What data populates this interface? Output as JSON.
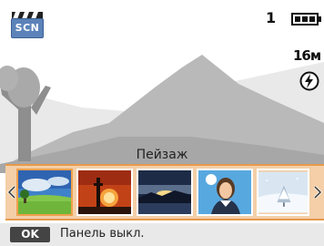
{
  "status": {
    "scene_mode_badge": "SCN",
    "shot_count": "1",
    "resolution": "16м",
    "battery_icon": "battery-full-icon",
    "flash_icon": "flash-auto-icon"
  },
  "scene": {
    "current_name": "Пейзаж",
    "thumbnails": [
      {
        "name": "landscape",
        "icon": "landscape-thumbnail",
        "selected": true
      },
      {
        "name": "sunset",
        "icon": "sunset-thumbnail",
        "selected": false
      },
      {
        "name": "dawn",
        "icon": "dawn-thumbnail",
        "selected": false
      },
      {
        "name": "portrait",
        "icon": "portrait-thumbnail",
        "selected": false
      },
      {
        "name": "snow",
        "icon": "snow-thumbnail",
        "selected": false
      }
    ]
  },
  "bottom_bar": {
    "key_label": "OK",
    "label": "Панель выкл."
  },
  "colors": {
    "strip_bg": "#f4cfa8",
    "strip_border": "#e69a4d",
    "scene_badge": "#5c83b9",
    "bottom_bar": "#e9e9e9"
  }
}
